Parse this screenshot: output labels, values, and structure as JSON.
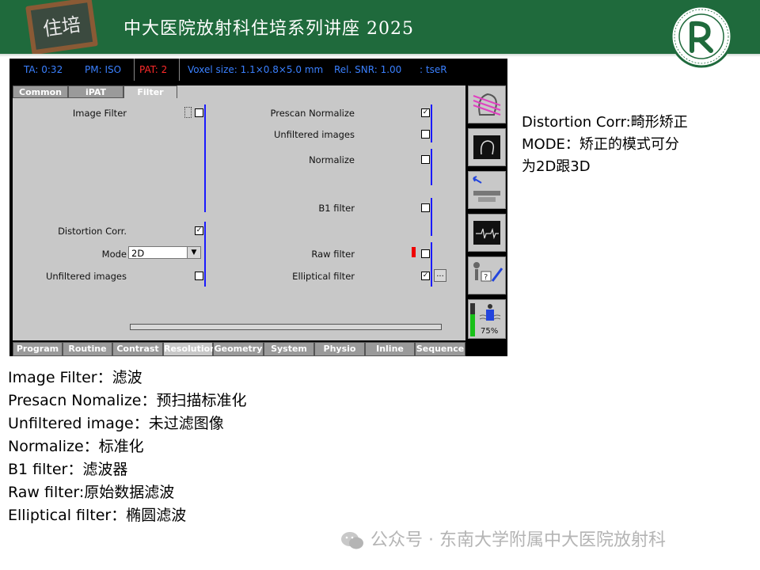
{
  "header": {
    "title": "中大医院放射科住培系列讲座 2025",
    "badge_text": "住培",
    "accent_color": "#1f6a3c"
  },
  "scanner": {
    "status": {
      "ta": "TA: 0:32",
      "pm": "PM: ISO",
      "pat": "PAT: 2",
      "voxel": "Voxel size: 1.1×0.8×5.0 mm",
      "snr": "Rel. SNR: 1.00",
      "seq": ": tseR"
    },
    "tabs": [
      "Common",
      "iPAT",
      "Filter"
    ],
    "left": {
      "image_filter": "Image Filter",
      "distortion": "Distortion Corr.",
      "mode_label": "Mode",
      "mode_value": "2D",
      "unfiltered": "Unfiltered images"
    },
    "right": {
      "prescan": "Prescan Normalize",
      "unfiltered": "Unfiltered images",
      "normalize": "Normalize",
      "b1": "B1 filter",
      "raw": "Raw filter",
      "elliptical": "Elliptical filter",
      "dots": "..."
    },
    "checks": {
      "image_filter": "",
      "distortion": "✓",
      "left_unfiltered": "",
      "prescan": "✓",
      "right_unfiltered": "",
      "normalize": "",
      "b1": "",
      "raw": "",
      "elliptical": "✓"
    },
    "bottom_tabs": [
      "Program",
      "Routine",
      "Contrast",
      "Resolution",
      "Geometry",
      "System",
      "Physio",
      "Inline",
      "Sequence"
    ],
    "side_percent": "75%"
  },
  "notes": {
    "right": [
      "Distortion Corr:畸形矫正",
      "MODE：矫正的模式可分",
      "为2D跟3D"
    ],
    "list": [
      "Image Filter：滤波",
      "Presacn Nomalize：预扫描标准化",
      "Unfiltered image：未过滤图像",
      "Normalize：标准化",
      "B1 filter：滤波器",
      "Raw filter:原始数据滤波",
      "Elliptical filter：椭圆滤波"
    ]
  },
  "footer": {
    "text": "公众号 · 东南大学附属中大医院放射科"
  }
}
